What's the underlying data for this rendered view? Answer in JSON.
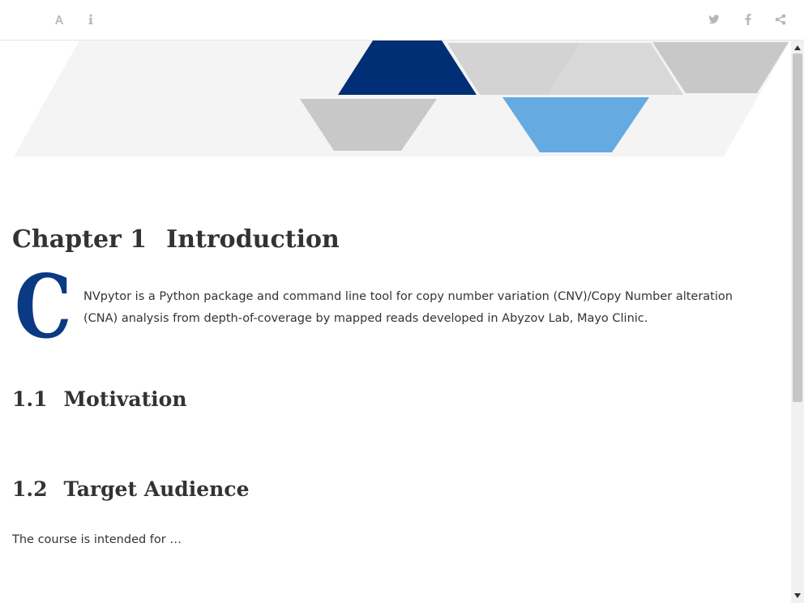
{
  "toolbar": {
    "font_button_icon": "font-icon",
    "info_button_icon": "info-icon",
    "twitter_button_icon": "twitter-icon",
    "facebook_button_icon": "facebook-icon",
    "share_button_icon": "share-icon"
  },
  "chapter": {
    "number": "Chapter 1",
    "title": "Introduction"
  },
  "intro": {
    "dropcap": "C",
    "text": "NVpytor is a Python package and command line tool for copy number variation (CNV)/Copy Number alteration (CNA) analysis from depth-of-coverage by mapped reads developed in Abyzov Lab, Mayo Clinic."
  },
  "sections": [
    {
      "number": "1.1",
      "title": "Motivation"
    },
    {
      "number": "1.2",
      "title": "Target Audience",
      "body": "The course is intended for …"
    }
  ],
  "colors": {
    "accent_dark_blue": "#002f75",
    "accent_light_blue": "#66aae2",
    "banner_grey": "#c8c8c8",
    "banner_bg": "#f4f4f4",
    "text": "#333333"
  }
}
